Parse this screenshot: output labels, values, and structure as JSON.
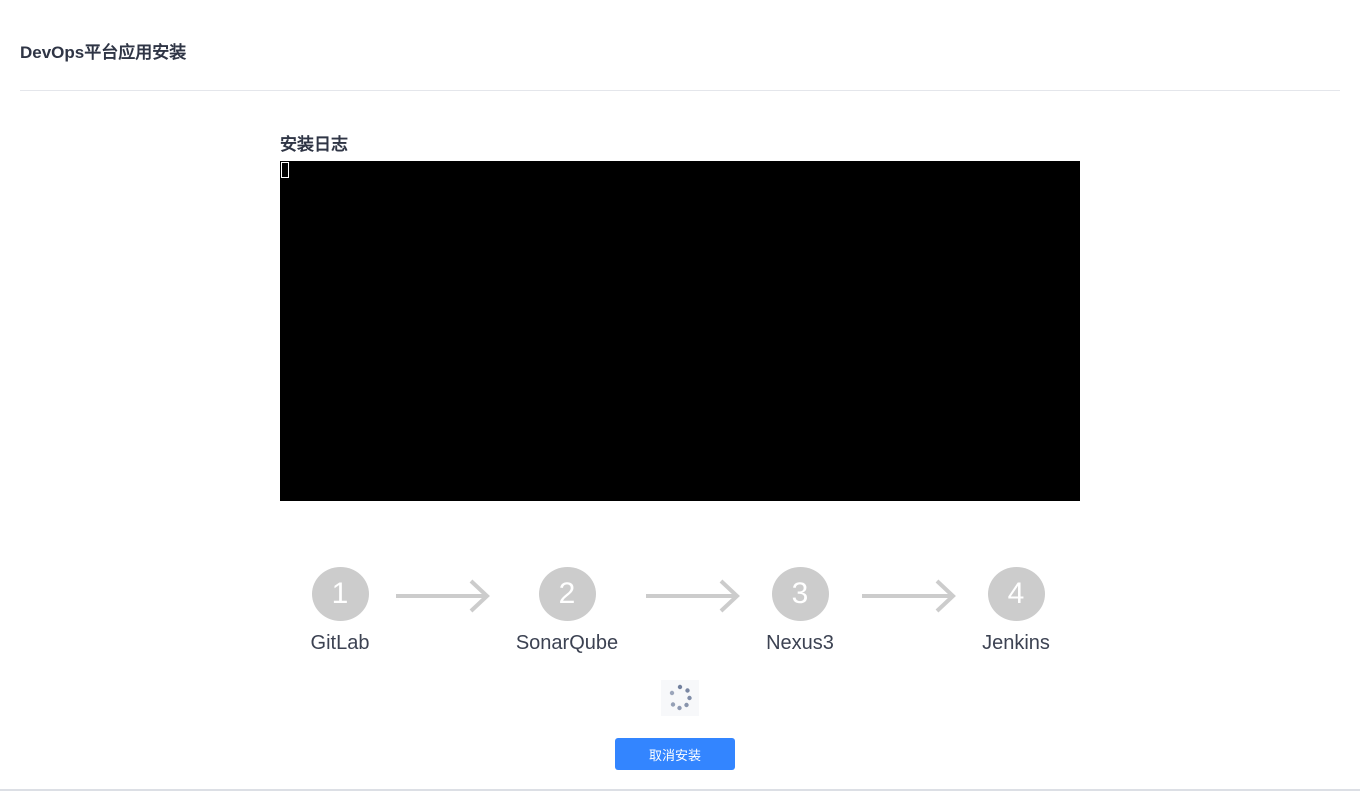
{
  "header": {
    "title": "DevOps平台应用安装"
  },
  "log": {
    "title": "安装日志",
    "content": ""
  },
  "steps": [
    {
      "number": "1",
      "label": "GitLab"
    },
    {
      "number": "2",
      "label": "SonarQube"
    },
    {
      "number": "3",
      "label": "Nexus3"
    },
    {
      "number": "4",
      "label": "Jenkins"
    }
  ],
  "icons": {
    "arrow": "arrow-right-icon",
    "spinner": "loading-spinner-icon"
  },
  "actions": {
    "cancel_label": "取消安装"
  },
  "colors": {
    "primary": "#3385ff",
    "step_inactive": "#cccccc",
    "terminal_bg": "#000000",
    "spinner": "#6b7a99"
  }
}
